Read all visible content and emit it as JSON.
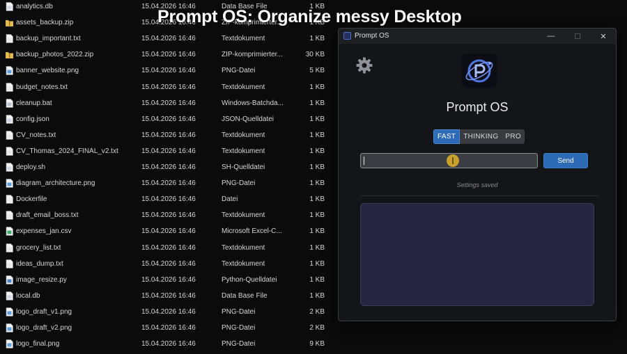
{
  "overlay": {
    "title": "Prompt OS: Organize messy Desktop"
  },
  "files": [
    {
      "name": "analytics.db",
      "date": "15.04.2026 16:46",
      "type": "Data Base File",
      "size": "1 KB",
      "icon": "doc-icon"
    },
    {
      "name": "assets_backup.zip",
      "date": "15.04.2026 16:46",
      "type": "ZIP-komprimierter...",
      "size": "1 KB",
      "icon": "folder-zip-icon"
    },
    {
      "name": "backup_important.txt",
      "date": "15.04.2026 16:46",
      "type": "Textdokument",
      "size": "1 KB",
      "icon": "text-file-icon"
    },
    {
      "name": "backup_photos_2022.zip",
      "date": "15.04.2026 16:46",
      "type": "ZIP-komprimierter...",
      "size": "30 KB",
      "icon": "folder-zip-icon"
    },
    {
      "name": "banner_website.png",
      "date": "15.04.2026 16:46",
      "type": "PNG-Datei",
      "size": "5 KB",
      "icon": "image-file-icon"
    },
    {
      "name": "budget_notes.txt",
      "date": "15.04.2026 16:46",
      "type": "Textdokument",
      "size": "1 KB",
      "icon": "text-file-icon"
    },
    {
      "name": "cleanup.bat",
      "date": "15.04.2026 16:46",
      "type": "Windows-Batchda...",
      "size": "1 KB",
      "icon": "batch-file-icon"
    },
    {
      "name": "config.json",
      "date": "15.04.2026 16:46",
      "type": "JSON-Quelldatei",
      "size": "1 KB",
      "icon": "doc-icon"
    },
    {
      "name": "CV_notes.txt",
      "date": "15.04.2026 16:46",
      "type": "Textdokument",
      "size": "1 KB",
      "icon": "text-file-icon"
    },
    {
      "name": "CV_Thomas_2024_FINAL_v2.txt",
      "date": "15.04.2026 16:46",
      "type": "Textdokument",
      "size": "1 KB",
      "icon": "text-file-icon"
    },
    {
      "name": "deploy.sh",
      "date": "15.04.2026 16:46",
      "type": "SH-Quelldatei",
      "size": "1 KB",
      "icon": "doc-icon"
    },
    {
      "name": "diagram_architecture.png",
      "date": "15.04.2026 16:46",
      "type": "PNG-Datei",
      "size": "1 KB",
      "icon": "image-file-icon"
    },
    {
      "name": "Dockerfile",
      "date": "15.04.2026 16:46",
      "type": "Datei",
      "size": "1 KB",
      "icon": "blank-file-icon"
    },
    {
      "name": "draft_email_boss.txt",
      "date": "15.04.2026 16:46",
      "type": "Textdokument",
      "size": "1 KB",
      "icon": "text-file-icon"
    },
    {
      "name": "expenses_jan.csv",
      "date": "15.04.2026 16:46",
      "type": "Microsoft Excel-C...",
      "size": "1 KB",
      "icon": "csv-file-icon"
    },
    {
      "name": "grocery_list.txt",
      "date": "15.04.2026 16:46",
      "type": "Textdokument",
      "size": "1 KB",
      "icon": "text-file-icon"
    },
    {
      "name": "ideas_dump.txt",
      "date": "15.04.2026 16:46",
      "type": "Textdokument",
      "size": "1 KB",
      "icon": "text-file-icon"
    },
    {
      "name": "image_resize.py",
      "date": "15.04.2026 16:46",
      "type": "Python-Quelldatei",
      "size": "1 KB",
      "icon": "python-file-icon"
    },
    {
      "name": "local.db",
      "date": "15.04.2026 16:46",
      "type": "Data Base File",
      "size": "1 KB",
      "icon": "doc-icon"
    },
    {
      "name": "logo_draft_v1.png",
      "date": "15.04.2026 16:46",
      "type": "PNG-Datei",
      "size": "2 KB",
      "icon": "image-file-icon"
    },
    {
      "name": "logo_draft_v2.png",
      "date": "15.04.2026 16:46",
      "type": "PNG-Datei",
      "size": "2 KB",
      "icon": "image-file-icon"
    },
    {
      "name": "logo_final.png",
      "date": "15.04.2026 16:46",
      "type": "PNG-Datei",
      "size": "9 KB",
      "icon": "image-file-icon"
    }
  ],
  "window": {
    "title": "Prompt OS",
    "controls": {
      "minimize": "—",
      "maximize": "☐",
      "close": "✕"
    }
  },
  "app": {
    "name": "Prompt OS",
    "modes": [
      {
        "label": "FAST",
        "active": true
      },
      {
        "label": "THINKING",
        "active": false
      },
      {
        "label": "PRO",
        "active": false
      }
    ],
    "input": {
      "value": "",
      "placeholder": ""
    },
    "send_label": "Send",
    "status": "Settings saved"
  },
  "colors": {
    "accent": "#2d6bb7",
    "window_bg": "#141518",
    "output_bg": "#262540",
    "cursor": "#d8ac2a"
  }
}
